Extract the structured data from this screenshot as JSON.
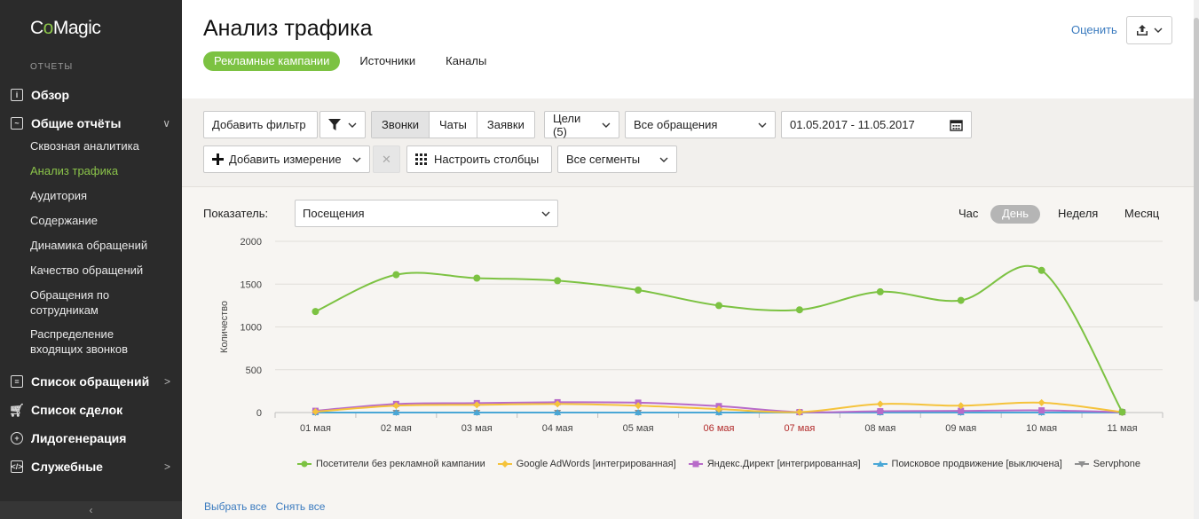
{
  "sidebar": {
    "logo": "CoMagic",
    "section_label": "ОТЧЕТЫ",
    "overview": "Обзор",
    "general_reports": "Общие отчёты",
    "sub_items": [
      "Сквозная аналитика",
      "Анализ трафика",
      "Аудитория",
      "Содержание",
      "Динамика обращений",
      "Качество обращений",
      "Обращения по сотрудникам",
      "Распределение входящих звонков"
    ],
    "calls_list": "Список обращений",
    "deals_list": "Список сделок",
    "leadgen": "Лидогенерация",
    "service": "Служебные"
  },
  "header": {
    "title": "Анализ трафика",
    "tabs": [
      "Рекламные кампании",
      "Источники",
      "Каналы"
    ],
    "rate_label": "Оценить"
  },
  "filters": {
    "add_filter": "Добавить фильтр",
    "types": [
      "Звонки",
      "Чаты",
      "Заявки"
    ],
    "goals": "Цели (5)",
    "all_requests": "Все обращения",
    "date_range": "01.05.2017 - 11.05.2017",
    "add_dimension": "Добавить измерение",
    "configure_columns": "Настроить столбцы",
    "all_segments": "Все сегменты"
  },
  "panel": {
    "metric_label": "Показатель:",
    "metric_value": "Посещения",
    "periods": [
      "Час",
      "День",
      "Неделя",
      "Месяц"
    ],
    "active_period": "День",
    "select_all": "Выбрать все",
    "deselect_all": "Снять все"
  },
  "chart_data": {
    "type": "line",
    "ylabel": "Количество",
    "ylim": [
      0,
      2000
    ],
    "yticks": [
      0,
      500,
      1000,
      1500,
      2000
    ],
    "categories": [
      "01 мая",
      "02 мая",
      "03 мая",
      "04 мая",
      "05 мая",
      "06 мая",
      "07 мая",
      "08 мая",
      "09 мая",
      "10 мая",
      "11 мая"
    ],
    "weekend_categories": [
      "06 мая",
      "07 мая"
    ],
    "series": [
      {
        "name": "Посетители без рекламной кампании",
        "color": "#7cc242",
        "marker": "circle",
        "values": [
          1180,
          1610,
          1570,
          1540,
          1430,
          1250,
          1200,
          1410,
          1310,
          1660,
          5
        ]
      },
      {
        "name": "Google AdWords [интегрированная]",
        "color": "#f5c33b",
        "marker": "diamond",
        "values": [
          10,
          80,
          90,
          100,
          80,
          40,
          5,
          100,
          80,
          115,
          5
        ]
      },
      {
        "name": "Яндекс.Директ [интегрированная]",
        "color": "#b86bc9",
        "marker": "square",
        "values": [
          20,
          100,
          110,
          120,
          115,
          75,
          5,
          15,
          20,
          25,
          5
        ]
      },
      {
        "name": "Поисковое продвижение [выключена]",
        "color": "#4aa7d6",
        "marker": "triangle",
        "values": [
          0,
          0,
          0,
          0,
          0,
          0,
          0,
          0,
          0,
          0,
          0
        ]
      },
      {
        "name": "Servphone",
        "color": "#8f8f8f",
        "marker": "triangle-down",
        "values": [
          0,
          0,
          0,
          0,
          0,
          0,
          0,
          0,
          0,
          0,
          0
        ]
      }
    ]
  }
}
